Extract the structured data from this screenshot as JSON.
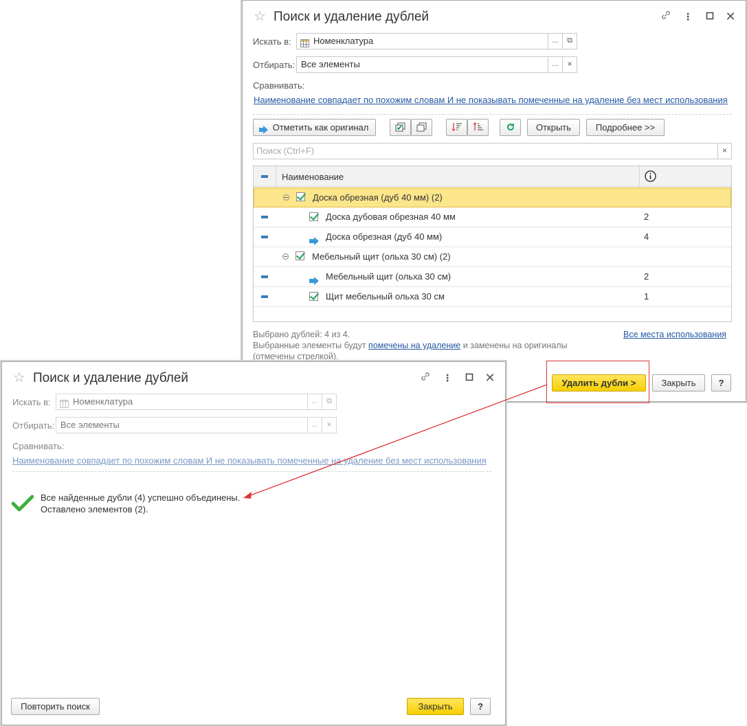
{
  "win1": {
    "title": "Поиск и удаление дублей",
    "search_in_label": "Искать в:",
    "search_in_value": "Номенклатура",
    "filter_label": "Отбирать:",
    "filter_value": "Все элементы",
    "compare_label": "Сравнивать:",
    "compare_link": "Наименование совпадает по похожим словам И не показывать помеченные на удаление без мест использования",
    "toolbar": {
      "mark_original": "Отметить как оригинал",
      "open": "Открыть",
      "more": "Подробнее >>"
    },
    "search_placeholder": "Поиск (Ctrl+F)",
    "grid": {
      "col_name": "Наименование",
      "col_info_icon": "info-icon",
      "rows": [
        {
          "name": "Доска обрезная (дуб 40 мм) (2)",
          "count": ""
        },
        {
          "name": "Доска дубовая обрезная 40 мм",
          "count": "2"
        },
        {
          "name": "Доска обрезная (дуб 40 мм)",
          "count": "4"
        },
        {
          "name": "Мебельный щит (ольха 30 см) (2)",
          "count": ""
        },
        {
          "name": "Мебельный щит (ольха 30 см)",
          "count": "2"
        },
        {
          "name": "Щит мебельный ольха 30  см",
          "count": "1"
        }
      ]
    },
    "status_selected": "Выбрано дублей: 4 из 4.",
    "status_line2_a": "Выбранные элементы будут ",
    "status_line2_link": "помечены на удаление",
    "status_line2_b": " и заменены на оригиналы",
    "status_line3": "(отмечены стрелкой).",
    "all_usages_link": "Все места использования",
    "delete_button": "Удалить дубли >",
    "close_button": "Закрыть",
    "help_button": "?"
  },
  "win2": {
    "title": "Поиск и удаление дублей",
    "search_in_label": "Искать в:",
    "search_in_value": "Номенклатура",
    "filter_label": "Отбирать:",
    "filter_value": "Все элементы",
    "compare_label": "Сравнивать:",
    "compare_link": "Наименование совпадает по похожим словам И не показывать помеченные на удаление без мест использования",
    "result_line1": "Все найденные дубли (4) успешно объединены.",
    "result_line2": "Оставлено элементов (2).",
    "repeat_button": "Повторить поиск",
    "close_button": "Закрыть",
    "help_button": "?"
  },
  "colors": {
    "accent_yellow": "#f6cf00",
    "link_blue": "#2659a3",
    "annotation_red": "#e0353b",
    "check_green": "#21a05a"
  }
}
